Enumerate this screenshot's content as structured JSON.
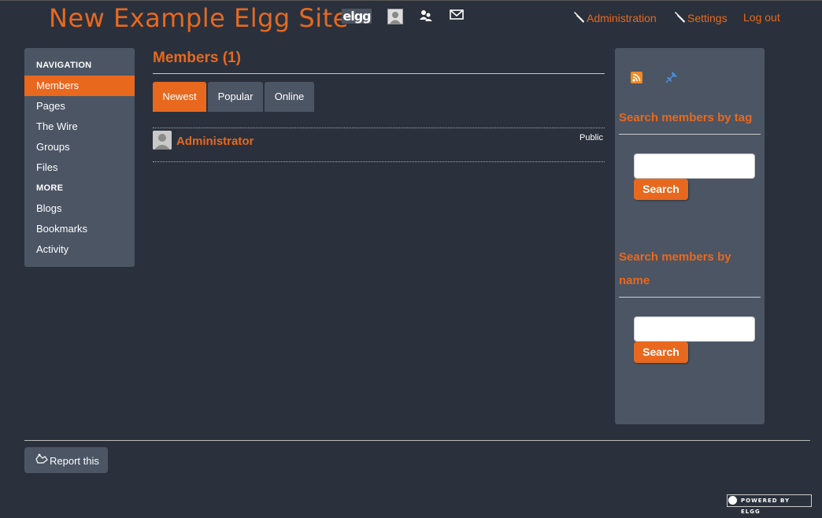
{
  "header": {
    "site_title": "New Example Elgg Site",
    "elgg_logo_text": "elgg",
    "icons": [
      "elgg-logo",
      "avatar-icon",
      "friends-icon",
      "mail-icon"
    ],
    "administration": "Administration",
    "settings": "Settings",
    "logout": "Log out"
  },
  "sidebar": {
    "navigation_heading": "NAVIGATION",
    "navigation_items": [
      {
        "label": "Members",
        "active": true
      },
      {
        "label": "Pages"
      },
      {
        "label": "The Wire"
      },
      {
        "label": "Groups"
      },
      {
        "label": "Files"
      }
    ],
    "more_heading": "MORE",
    "more_items": [
      {
        "label": "Blogs"
      },
      {
        "label": "Bookmarks"
      },
      {
        "label": "Activity"
      }
    ]
  },
  "main": {
    "title": "Members (1)",
    "tabs": [
      {
        "label": "Newest",
        "active": true
      },
      {
        "label": "Popular"
      },
      {
        "label": "Online"
      }
    ],
    "members": [
      {
        "name": "Administrator",
        "access": "Public"
      }
    ]
  },
  "rightbar": {
    "icons": [
      "rss-icon",
      "pin-icon"
    ],
    "tag_search_heading": "Search members by tag",
    "tag_search_button": "Search",
    "tag_search_value": "",
    "name_search_heading": "Search members by name",
    "name_search_button": "Search",
    "name_search_value": ""
  },
  "footer": {
    "report_label": "Report this",
    "powered_by": "POWERED BY ELGG"
  },
  "colors": {
    "accent": "#e8681e",
    "background": "#2a313c",
    "panel": "#4b5564"
  }
}
